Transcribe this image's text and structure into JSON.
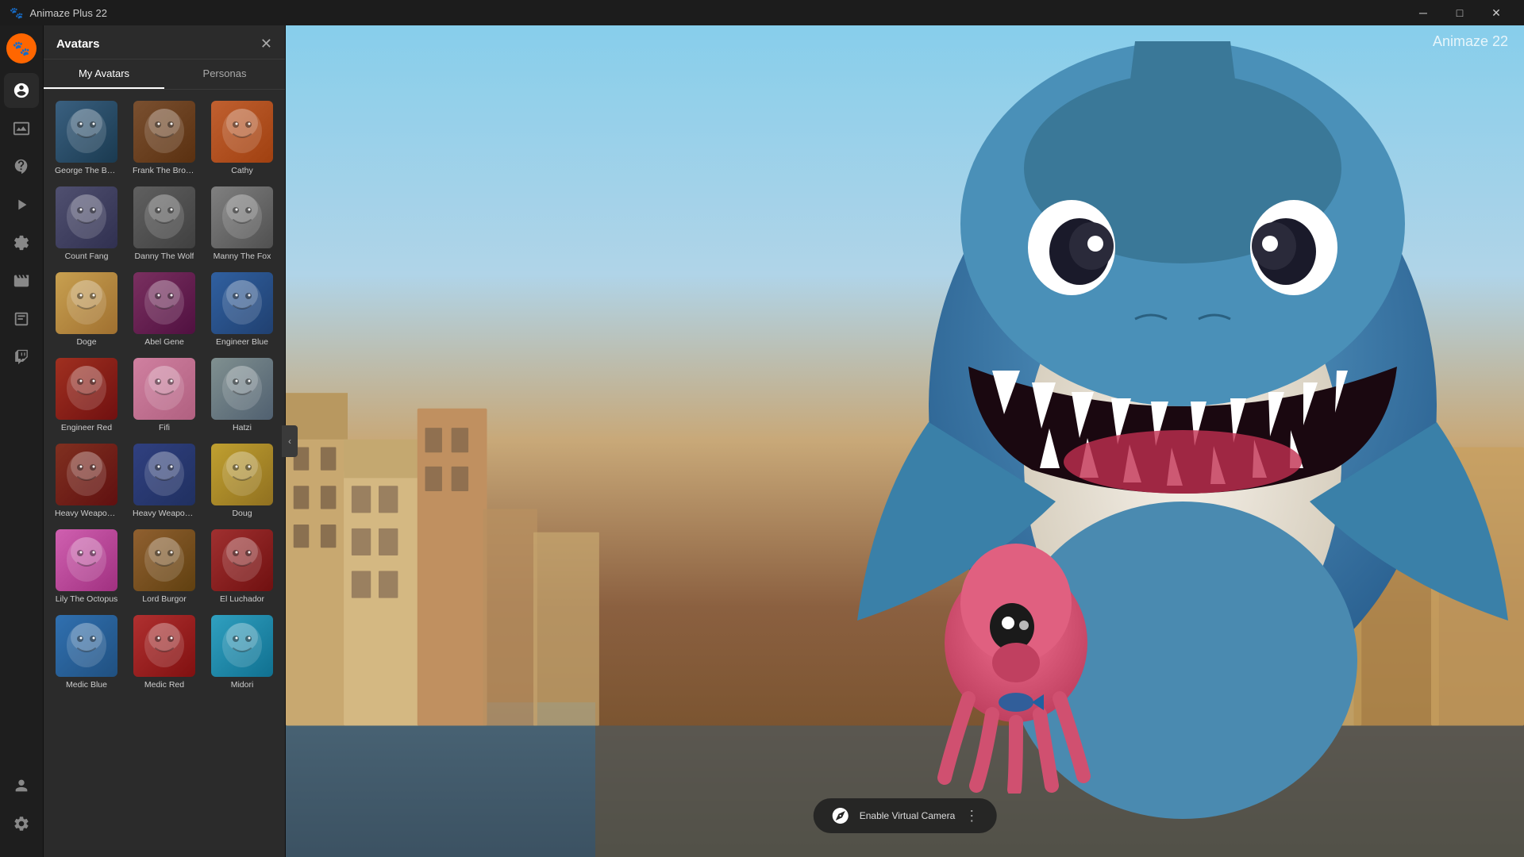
{
  "app": {
    "title": "Animaze Plus 22",
    "top_right_label": "Animaze 22"
  },
  "titlebar": {
    "title": "Animaze Plus 22",
    "minimize_label": "─",
    "maximize_label": "□",
    "close_label": "✕"
  },
  "sidebar": {
    "icons": [
      {
        "name": "logo",
        "symbol": "🐾",
        "active": false
      },
      {
        "name": "avatars",
        "symbol": "🎭",
        "active": true
      },
      {
        "name": "scenes",
        "symbol": "🖼",
        "active": false
      },
      {
        "name": "effects",
        "symbol": "✨",
        "active": false
      },
      {
        "name": "motion",
        "symbol": "🎬",
        "active": false
      },
      {
        "name": "props",
        "symbol": "🎪",
        "active": false
      },
      {
        "name": "film",
        "symbol": "🎞",
        "active": false
      },
      {
        "name": "overlay",
        "symbol": "⊞",
        "active": false
      },
      {
        "name": "twitch",
        "symbol": "📡",
        "active": false
      }
    ],
    "bottom_icons": [
      {
        "name": "user",
        "symbol": "👤"
      },
      {
        "name": "settings",
        "symbol": "⚙"
      }
    ]
  },
  "avatars_panel": {
    "title": "Avatars",
    "tabs": [
      {
        "id": "my-avatars",
        "label": "My Avatars",
        "active": true
      },
      {
        "id": "personas",
        "label": "Personas",
        "active": false
      }
    ],
    "avatars": [
      {
        "id": "george",
        "name": "George The Bo...",
        "colorClass": "av-george",
        "icon": "🦈"
      },
      {
        "id": "frank",
        "name": "Frank The Brown...",
        "colorClass": "av-frank",
        "icon": "🐻"
      },
      {
        "id": "cathy",
        "name": "Cathy",
        "colorClass": "av-cathy",
        "icon": "🦊"
      },
      {
        "id": "countfang",
        "name": "Count Fang",
        "colorClass": "av-countfang",
        "icon": "🐺"
      },
      {
        "id": "danny",
        "name": "Danny The Wolf",
        "colorClass": "av-danny",
        "icon": "🐺"
      },
      {
        "id": "manny",
        "name": "Manny The Fox",
        "colorClass": "av-manny",
        "icon": "🦊"
      },
      {
        "id": "doge",
        "name": "Doge",
        "colorClass": "av-doge",
        "icon": "🐕"
      },
      {
        "id": "abel",
        "name": "Abel Gene",
        "colorClass": "av-abel",
        "icon": "🍆"
      },
      {
        "id": "engineer-blue",
        "name": "Engineer Blue",
        "colorClass": "av-engineer-blue",
        "icon": "🔧"
      },
      {
        "id": "engineer-red",
        "name": "Engineer Red",
        "colorClass": "av-engineer-red",
        "icon": "🔧"
      },
      {
        "id": "fifi",
        "name": "Fifi",
        "colorClass": "av-fifi",
        "icon": "🐱"
      },
      {
        "id": "hatzi",
        "name": "Hatzi",
        "colorClass": "av-hatzi",
        "icon": "🐺"
      },
      {
        "id": "heavy-red",
        "name": "Heavy Weapons...",
        "colorClass": "av-heavy-red",
        "icon": "💪"
      },
      {
        "id": "heavy-blue",
        "name": "Heavy Weapons...",
        "colorClass": "av-heavy-blue",
        "icon": "💪"
      },
      {
        "id": "doug",
        "name": "Doug",
        "colorClass": "av-doug",
        "icon": "🌭"
      },
      {
        "id": "lily",
        "name": "Lily The Octopus",
        "colorClass": "av-lily",
        "icon": "🐙"
      },
      {
        "id": "lordburger",
        "name": "Lord Burgor",
        "colorClass": "av-lordburger",
        "icon": "🍔"
      },
      {
        "id": "luchador",
        "name": "El Luchador",
        "colorClass": "av-luchador",
        "icon": "🥊"
      },
      {
        "id": "medic-blue",
        "name": "Medic Blue",
        "colorClass": "av-medic-blue",
        "icon": "🏥"
      },
      {
        "id": "medic-red",
        "name": "Medic Red",
        "colorClass": "av-medic-red",
        "icon": "🏥"
      },
      {
        "id": "midori",
        "name": "Midori",
        "colorClass": "av-midori",
        "icon": "💙"
      }
    ]
  },
  "camera": {
    "icon": "📡",
    "label": "Enable Virtual Camera",
    "dots": "⋮"
  },
  "collapse": {
    "icon": "‹"
  }
}
